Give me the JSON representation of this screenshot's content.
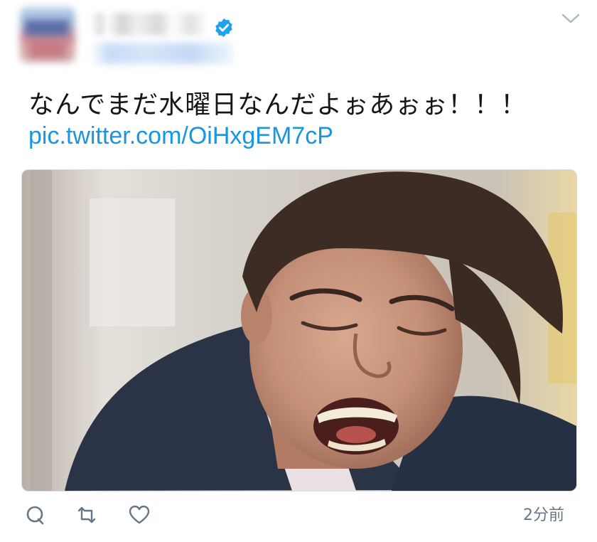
{
  "tweet": {
    "text": "なんでまだ水曜日なんだよぉあぉぉ！！！",
    "link": "pic.twitter.com/OiHxgEM7cP",
    "timestamp": "2分前"
  },
  "icons": {
    "verified": "verified-badge-icon",
    "more": "chevron-down-icon",
    "reply": "reply-icon",
    "retweet": "retweet-icon",
    "like": "heart-icon"
  },
  "colors": {
    "link": "#1b95e0",
    "text": "#14171a",
    "meta": "#657786",
    "verified": "#1da1f2",
    "suit": "#2b3447"
  }
}
